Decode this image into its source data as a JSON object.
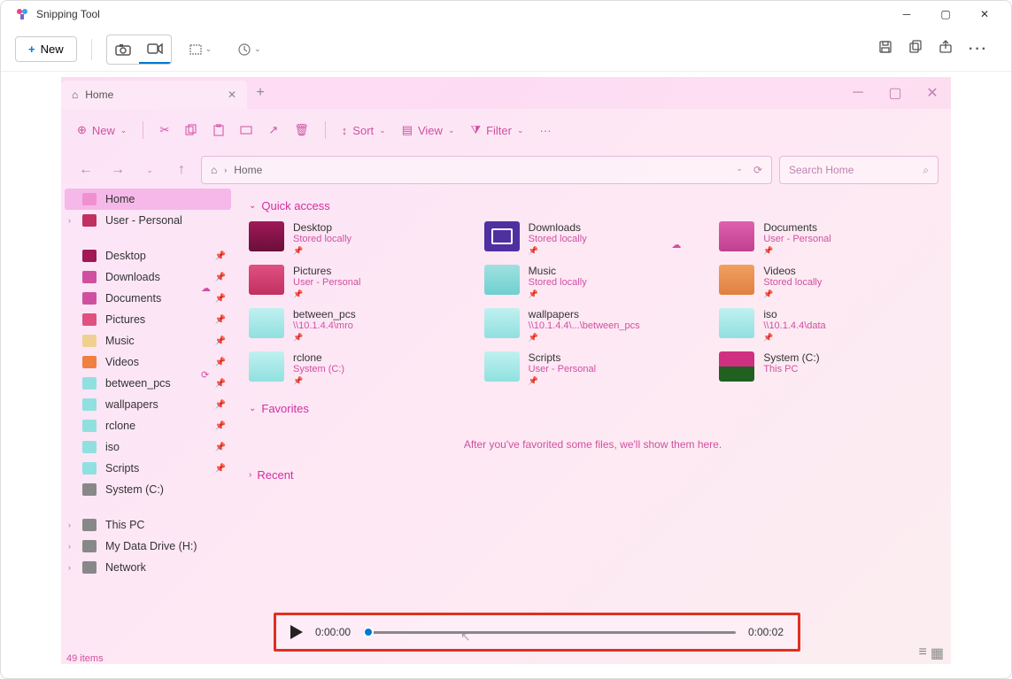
{
  "app": {
    "title": "Snipping Tool"
  },
  "toolbar": {
    "new_label": "New"
  },
  "explorer": {
    "tab": "Home",
    "toolbar": {
      "new": "New",
      "sort": "Sort",
      "view": "View",
      "filter": "Filter"
    },
    "breadcrumb": "Home",
    "search_placeholder": "Search Home",
    "sidebar": {
      "home": "Home",
      "user": "User - Personal",
      "pins": [
        {
          "label": "Desktop"
        },
        {
          "label": "Downloads"
        },
        {
          "label": "Documents"
        },
        {
          "label": "Pictures"
        },
        {
          "label": "Music"
        },
        {
          "label": "Videos"
        },
        {
          "label": "between_pcs"
        },
        {
          "label": "wallpapers"
        },
        {
          "label": "rclone"
        },
        {
          "label": "iso"
        },
        {
          "label": "Scripts"
        },
        {
          "label": "System (C:)"
        }
      ],
      "bottom": [
        {
          "label": "This PC"
        },
        {
          "label": "My Data Drive (H:)"
        },
        {
          "label": "Network"
        }
      ]
    },
    "sections": {
      "quick": "Quick access",
      "fav": "Favorites",
      "recent": "Recent"
    },
    "quick": [
      {
        "name": "Desktop",
        "sub": "Stored locally",
        "cls": "f-desktop",
        "pin": true
      },
      {
        "name": "Downloads",
        "sub": "Stored locally",
        "cls": "f-downloads",
        "pin": true
      },
      {
        "name": "Documents",
        "sub": "User - Personal",
        "cls": "f-documents",
        "pin": true,
        "cloud": true
      },
      {
        "name": "Pictures",
        "sub": "User - Personal",
        "cls": "f-pictures",
        "pin": true,
        "cloud": true
      },
      {
        "name": "Music",
        "sub": "Stored locally",
        "cls": "f-music",
        "pin": true
      },
      {
        "name": "Videos",
        "sub": "Stored locally",
        "cls": "f-videos",
        "pin": true
      },
      {
        "name": "between_pcs",
        "sub": "\\\\10.1.4.4\\mro",
        "cls": "f-folder",
        "pin": true
      },
      {
        "name": "wallpapers",
        "sub": "\\\\10.1.4.4\\...\\between_pcs",
        "cls": "f-folder",
        "pin": true
      },
      {
        "name": "iso",
        "sub": "\\\\10.1.4.4\\data",
        "cls": "f-folder",
        "pin": true
      },
      {
        "name": "rclone",
        "sub": "System (C:)",
        "cls": "f-folder",
        "pin": true,
        "sync": true
      },
      {
        "name": "Scripts",
        "sub": "User - Personal",
        "cls": "f-folder",
        "pin": true
      },
      {
        "name": "System (C:)",
        "sub": "This PC",
        "cls": "f-sys",
        "pin": false
      }
    ],
    "fav_empty": "After you've favorited some files, we'll show them here.",
    "status": "49 items"
  },
  "video": {
    "current": "0:00:00",
    "total": "0:00:02"
  }
}
